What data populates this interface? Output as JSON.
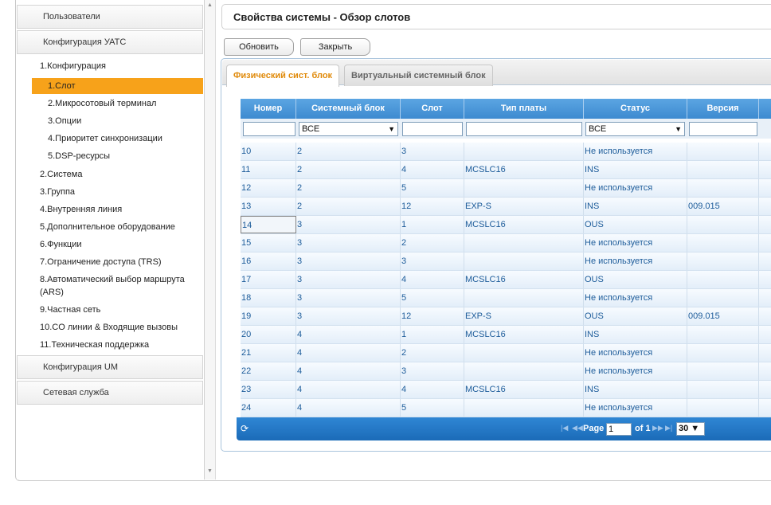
{
  "sidebar": {
    "headers": [
      "Пользователи",
      "Конфигурация УАТС",
      "Конфигурация UM",
      "Сетевая служба"
    ],
    "items": [
      {
        "label": "1.Конфигурация",
        "level": 1
      },
      {
        "label": "1.Слот",
        "level": 2,
        "active": true
      },
      {
        "label": "2.Микросотовый терминал",
        "level": 2
      },
      {
        "label": "3.Опции",
        "level": 2
      },
      {
        "label": "4.Приоритет синхронизации",
        "level": 2
      },
      {
        "label": "5.DSP-ресурсы",
        "level": 2
      },
      {
        "label": "2.Система",
        "level": 1
      },
      {
        "label": "3.Группа",
        "level": 1
      },
      {
        "label": "4.Внутренняя линия",
        "level": 1
      },
      {
        "label": "5.Дополнительное оборудование",
        "level": 1
      },
      {
        "label": "6.Функции",
        "level": 1
      },
      {
        "label": "7.Ограничение доступа (TRS)",
        "level": 1
      },
      {
        "label": "8.Автоматический выбор маршрута (ARS)",
        "level": 1
      },
      {
        "label": "9.Частная сеть",
        "level": 1
      },
      {
        "label": "10.CO линии & Входящие вызовы",
        "level": 1
      },
      {
        "label": "11.Техническая поддержка",
        "level": 1
      }
    ]
  },
  "page": {
    "title": "Свойства системы - Обзор слотов",
    "refresh_label": "Обновить",
    "close_label": "Закрыть"
  },
  "tabs": [
    "Физический сист. блок",
    "Виртуальный системный блок"
  ],
  "grid": {
    "columns": [
      "Номер",
      "Системный блок",
      "Слот",
      "Тип платы",
      "Статус",
      "Версия"
    ],
    "filters": {
      "system_block": "ВСЕ",
      "status": "ВСЕ"
    },
    "rows": [
      [
        "10",
        "2",
        "3",
        "",
        "Не используется",
        ""
      ],
      [
        "11",
        "2",
        "4",
        "MCSLC16",
        "INS",
        ""
      ],
      [
        "12",
        "2",
        "5",
        "",
        "Не используется",
        ""
      ],
      [
        "13",
        "2",
        "12",
        "EXP-S",
        "INS",
        "009.015"
      ],
      [
        "14",
        "3",
        "1",
        "MCSLC16",
        "OUS",
        ""
      ],
      [
        "15",
        "3",
        "2",
        "",
        "Не используется",
        ""
      ],
      [
        "16",
        "3",
        "3",
        "",
        "Не используется",
        ""
      ],
      [
        "17",
        "3",
        "4",
        "MCSLC16",
        "OUS",
        ""
      ],
      [
        "18",
        "3",
        "5",
        "",
        "Не используется",
        ""
      ],
      [
        "19",
        "3",
        "12",
        "EXP-S",
        "OUS",
        "009.015"
      ],
      [
        "20",
        "4",
        "1",
        "MCSLC16",
        "INS",
        ""
      ],
      [
        "21",
        "4",
        "2",
        "",
        "Не используется",
        ""
      ],
      [
        "22",
        "4",
        "3",
        "",
        "Не используется",
        ""
      ],
      [
        "23",
        "4",
        "4",
        "MCSLC16",
        "INS",
        ""
      ],
      [
        "24",
        "4",
        "5",
        "",
        "Не используется",
        ""
      ]
    ]
  },
  "pager": {
    "page_label": "Page",
    "page_value": "1",
    "of_label": "of 1",
    "page_size": "30"
  }
}
